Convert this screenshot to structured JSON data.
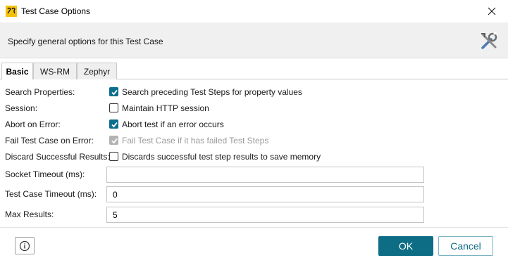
{
  "window": {
    "title": "Test Case Options"
  },
  "header": {
    "description": "Specify general options for this Test Case"
  },
  "tabs": [
    {
      "label": "Basic",
      "active": true
    },
    {
      "label": "WS-RM",
      "active": false
    },
    {
      "label": "Zephyr",
      "active": false
    }
  ],
  "options": {
    "search_properties": {
      "label": "Search Properties:",
      "text": "Search preceding Test Steps for property values",
      "checked": true
    },
    "session": {
      "label": "Session:",
      "text": "Maintain HTTP session",
      "checked": false
    },
    "abort_on_error": {
      "label": "Abort on Error:",
      "text": "Abort test if an error occurs",
      "checked": true
    },
    "fail_test_case": {
      "label": "Fail Test Case on Error:",
      "text": "Fail Test Case if it has failed Test Steps",
      "checked": true,
      "disabled": true
    },
    "discard_results": {
      "label": "Discard Successful Results:",
      "text": "Discards successful test step results to save memory",
      "checked": false
    }
  },
  "fields": {
    "socket_timeout": {
      "label": "Socket Timeout (ms):",
      "value": ""
    },
    "test_case_timeout": {
      "label": "Test Case Timeout (ms):",
      "value": "0"
    },
    "max_results": {
      "label": "Max Results:",
      "value": "5"
    }
  },
  "footer": {
    "ok_label": "OK",
    "cancel_label": "Cancel"
  },
  "colors": {
    "accent": "#0c6d85",
    "checkbox_checked": "#0a6e8c",
    "checkbox_disabled": "#b3b3b3"
  },
  "icons": {
    "app": "soapui-app-icon",
    "close": "close-icon",
    "tools": "tools-icon",
    "info": "info-icon"
  }
}
